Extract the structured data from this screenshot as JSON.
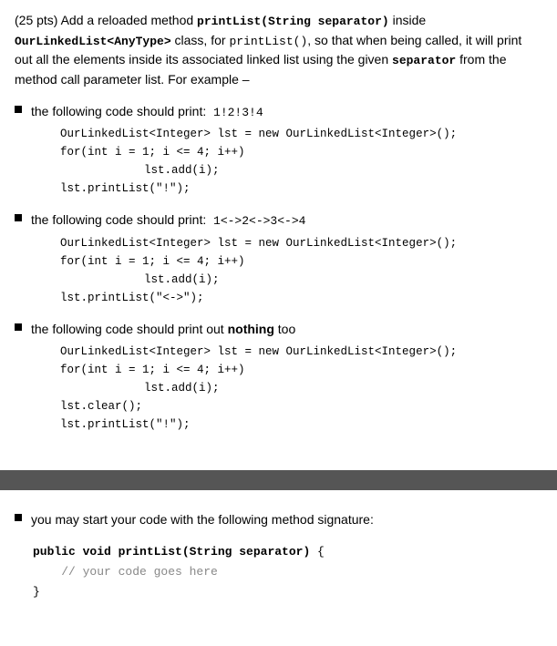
{
  "header": {
    "points": "(25 pts)",
    "description_plain": " Add a reloaded method ",
    "method_name": "printList(String separator)",
    "description_2": " inside ",
    "class_name": "OurLinkedList<AnyType>",
    "description_3": " class, for ",
    "method_ref": "printList()",
    "description_4": ", so that when being called, it will print out all the elements inside its associated linked list using the given ",
    "separator_kw": "separator",
    "description_5": " from the method call parameter list. For example –"
  },
  "bullets": [
    {
      "prefix": "the following code should print: ",
      "print_value": "1!2!3!4",
      "code_lines": [
        "OurLinkedList<Integer> lst = new OurLinkedList<Integer>();",
        "for(int i = 1; i <= 4; i++)",
        "        lst.add(i);",
        "lst.printList(\"!\");"
      ]
    },
    {
      "prefix": "the following code should print: ",
      "print_value": "1<->2<->3<->4",
      "code_lines": [
        "OurLinkedList<Integer> lst = new OurLinkedList<Integer>();",
        "for(int i = 1; i <= 4; i++)",
        "        lst.add(i);",
        "lst.printList(\"<->\");"
      ]
    },
    {
      "prefix": "the following code should print out ",
      "bold_word": "nothing",
      "suffix": " too",
      "code_lines": [
        "OurLinkedList<Integer> lst = new OurLinkedList<Integer>();",
        "for(int i = 1; i <= 4; i++)",
        "        lst.add(i);",
        "lst.clear();",
        "lst.printList(\"!\");"
      ]
    }
  ],
  "bottom_bullet": {
    "text": "you may start your code with the following method signature:"
  },
  "method_signature": {
    "line1": "public void printList(String separator) {",
    "line2": "    // your code goes here",
    "line3": "}"
  }
}
